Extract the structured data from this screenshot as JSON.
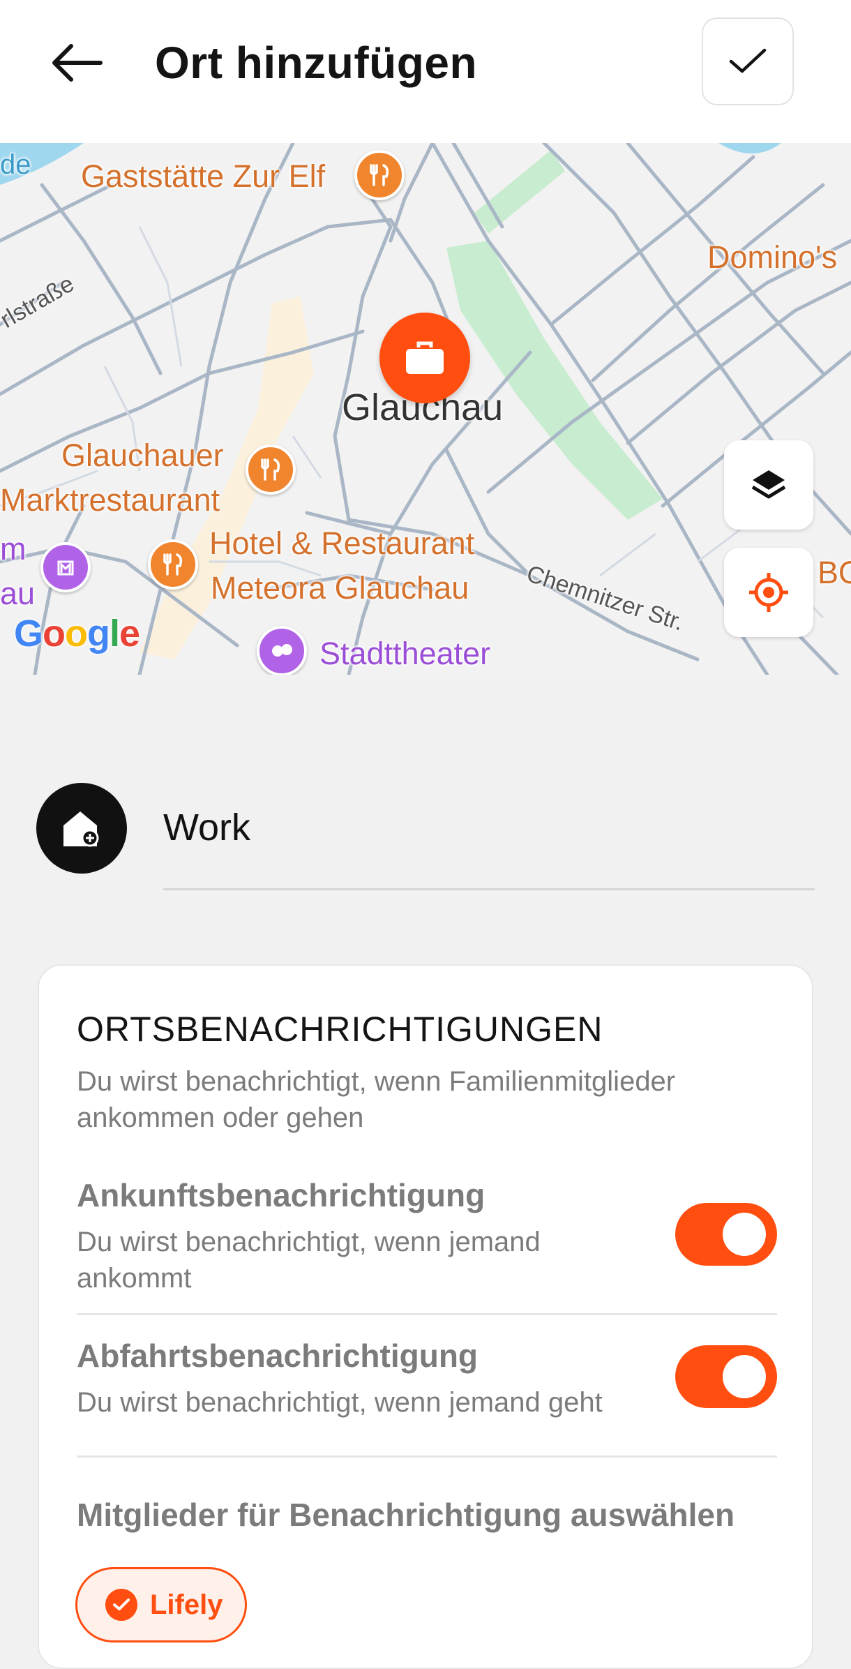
{
  "header": {
    "title": "Ort hinzufügen",
    "back_icon": "arrow-left-icon",
    "confirm_icon": "check-icon"
  },
  "map": {
    "center_label": "Glauchau",
    "pin_icon": "briefcase-icon",
    "labels": {
      "gaststaette": "Gaststätte Zur Elf",
      "dominos": "Domino's",
      "street_left": "rlstraße",
      "glauchauer": "Glauchauer",
      "marktrestaurant": "Marktrestaurant",
      "hotel_line1": "Hotel & Restaurant",
      "hotel_line2": "Meteora Glauchau",
      "chemnitzer": "Chemnitzer Str.",
      "stadttheater": "Stadttheater",
      "edge_m": "m",
      "edge_au": "au",
      "edge_de": "de",
      "edge_bo": "BO"
    },
    "attribution": "Google",
    "layers_icon": "layers-icon",
    "locate_icon": "crosshair-icon"
  },
  "place": {
    "name": "Work",
    "icon": "home-add-icon"
  },
  "notifications": {
    "title": "ORTSBENACHRICHTIGUNGEN",
    "description": "Du wirst benachrichtigt, wenn Familienmitglieder ankommen oder gehen",
    "arrival": {
      "title": "Ankunftsbenachrichtigung",
      "subtitle": "Du wirst benachrichtigt, wenn jemand ankommt",
      "enabled": true
    },
    "departure": {
      "title": "Abfahrtsbenachrichtigung",
      "subtitle": "Du wirst benachrichtigt, wenn jemand geht",
      "enabled": true
    },
    "members_title": "Mitglieder für Benachrichtigung auswählen",
    "members": [
      {
        "name": "Lifely",
        "selected": true
      }
    ]
  },
  "colors": {
    "accent": "#ff4e0f",
    "poi_food": "#f0852d",
    "poi_culture": "#b163e8",
    "park": "#c8eccf"
  }
}
